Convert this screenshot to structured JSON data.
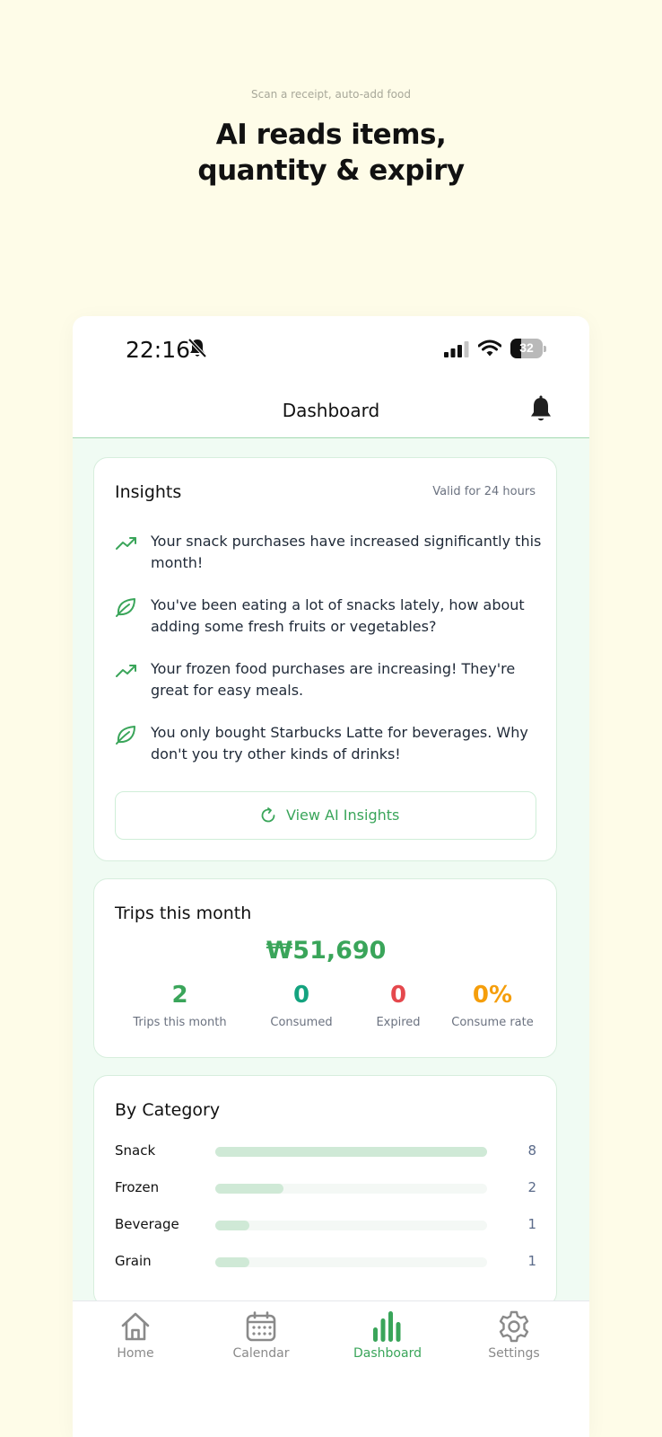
{
  "promo": {
    "subtitle": "Scan a receipt, auto-add food",
    "title_line1": "AI reads items,",
    "title_line2": "quantity & expiry"
  },
  "status_bar": {
    "time": "22:16",
    "battery": "32"
  },
  "header": {
    "title": "Dashboard"
  },
  "insights": {
    "title": "Insights",
    "validity": "Valid for 24 hours",
    "items": [
      {
        "icon": "trend-up-icon",
        "text": "Your snack purchases have increased significantly this month!"
      },
      {
        "icon": "leaf-icon",
        "text": "You've been eating a lot of snacks lately, how about adding some fresh fruits or vegetables?"
      },
      {
        "icon": "trend-up-icon",
        "text": "Your frozen food purchases are increasing! They're great for easy meals."
      },
      {
        "icon": "leaf-icon",
        "text": "You only bought Starbucks Latte for beverages. Why don't you try other kinds of drinks!"
      }
    ],
    "button_label": "View AI Insights"
  },
  "trips": {
    "title": "Trips this month",
    "total": "₩51,690",
    "stats": [
      {
        "value": "2",
        "label": "Trips this month",
        "color": "#3aa55a"
      },
      {
        "value": "0",
        "label": "Consumed",
        "color": "#14a37f"
      },
      {
        "value": "0",
        "label": "Expired",
        "color": "#e5484d"
      },
      {
        "value": "0%",
        "label": "Consume rate",
        "color": "#f59e0b"
      }
    ]
  },
  "by_category": {
    "title": "By Category",
    "max": 8,
    "items": [
      {
        "name": "Snack",
        "count": 8
      },
      {
        "name": "Frozen",
        "count": 2
      },
      {
        "name": "Beverage",
        "count": 1
      },
      {
        "name": "Grain",
        "count": 1
      }
    ]
  },
  "tabs": [
    {
      "label": "Home",
      "icon": "home-icon",
      "active": false
    },
    {
      "label": "Calendar",
      "icon": "calendar-icon",
      "active": false
    },
    {
      "label": "Dashboard",
      "icon": "bar-chart-icon",
      "active": true
    },
    {
      "label": "Settings",
      "icon": "gear-icon",
      "active": false
    }
  ],
  "colors": {
    "accent": "#3aa55a",
    "background": "#fefce8",
    "bar_fill": "#cfe9d6"
  }
}
